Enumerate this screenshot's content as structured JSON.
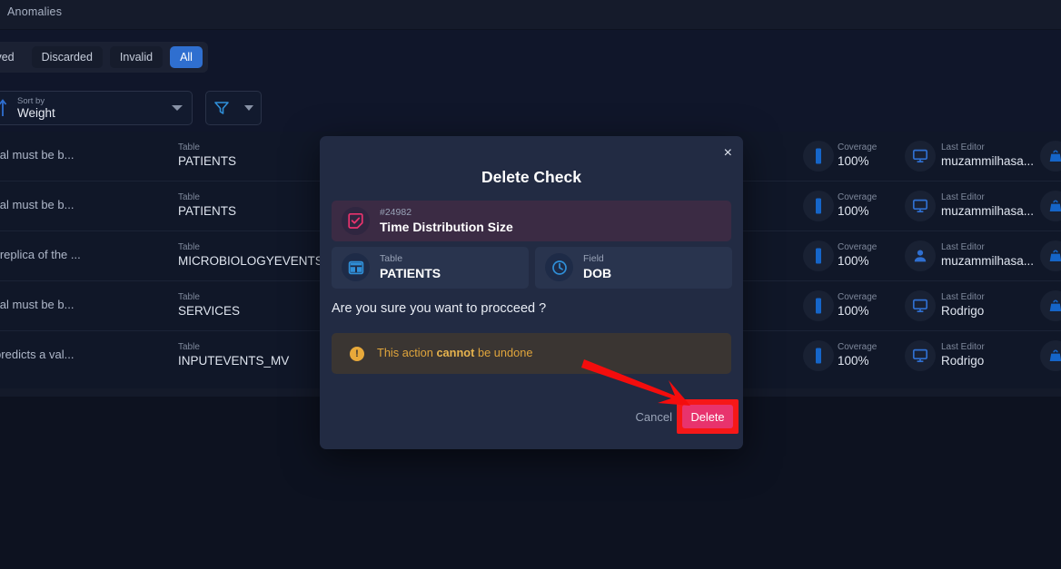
{
  "header": {
    "title": "Anomalies"
  },
  "filters": {
    "chips": [
      {
        "label": "Archived",
        "active": false
      },
      {
        "label": "Discarded",
        "active": false
      },
      {
        "label": "Invalid",
        "active": false
      },
      {
        "label": "All",
        "active": true
      }
    ]
  },
  "controls": {
    "sort": {
      "label": "Sort by",
      "value": "Weight",
      "icon": "sort-numeric-asc-icon"
    },
    "filter": {
      "icon": "funnel-icon"
    }
  },
  "table": {
    "labels": {
      "table": "Table",
      "coverage": "Coverage",
      "last_editor": "Last Editor"
    },
    "rows": [
      {
        "description": "h time-series interval must be b...",
        "table": "PATIENTS",
        "coverage": "100%",
        "last_editor": "muzammilhasa...",
        "editor_icon": "monitor-icon"
      },
      {
        "description": "h time-series interval must be b...",
        "table": "PATIENTS",
        "coverage": "100%",
        "last_editor": "muzammilhasa...",
        "editor_icon": "monitor-icon"
      },
      {
        "description": "eference table is a replica of the ...",
        "table": "MICROBIOLOGYEVENTS_REF",
        "coverage": "100%",
        "last_editor": "muzammilhasa...",
        "editor_icon": "person-icon"
      },
      {
        "description": "h time-series interval must be b...",
        "table": "SERVICES",
        "coverage": "100%",
        "last_editor": "Rodrigo",
        "editor_icon": "monitor-icon"
      },
      {
        "description": "ferred expression predicts a val...",
        "table": "INPUTEVENTS_MV",
        "coverage": "100%",
        "last_editor": "Rodrigo",
        "editor_icon": "monitor-icon"
      }
    ]
  },
  "modal": {
    "title": "Delete Check",
    "close_label": "×",
    "check": {
      "id": "#24982",
      "name": "Time Distribution Size",
      "icon": "check-square-icon"
    },
    "table_card": {
      "label": "Table",
      "value": "PATIENTS",
      "icon": "table-grid-icon"
    },
    "field_card": {
      "label": "Field",
      "value": "DOB",
      "icon": "clock-icon"
    },
    "question": "Are you sure you want to procceed ?",
    "warning": {
      "icon": "warning-exclamation-icon",
      "prefix": "This action ",
      "emphasis": "cannot",
      "suffix": " be undone"
    },
    "cancel_label": "Cancel",
    "delete_label": "Delete"
  },
  "annotation": {
    "arrow": "red-arrow-pointer",
    "highlight": "red-highlight-box"
  },
  "colors": {
    "accent_blue": "#2f6fd0",
    "delete_pink": "#e8336d",
    "highlight_red": "#f61818",
    "warning_amber": "#e0a53c",
    "modal_bg": "#222b43",
    "page_bg": "#0d1220"
  }
}
